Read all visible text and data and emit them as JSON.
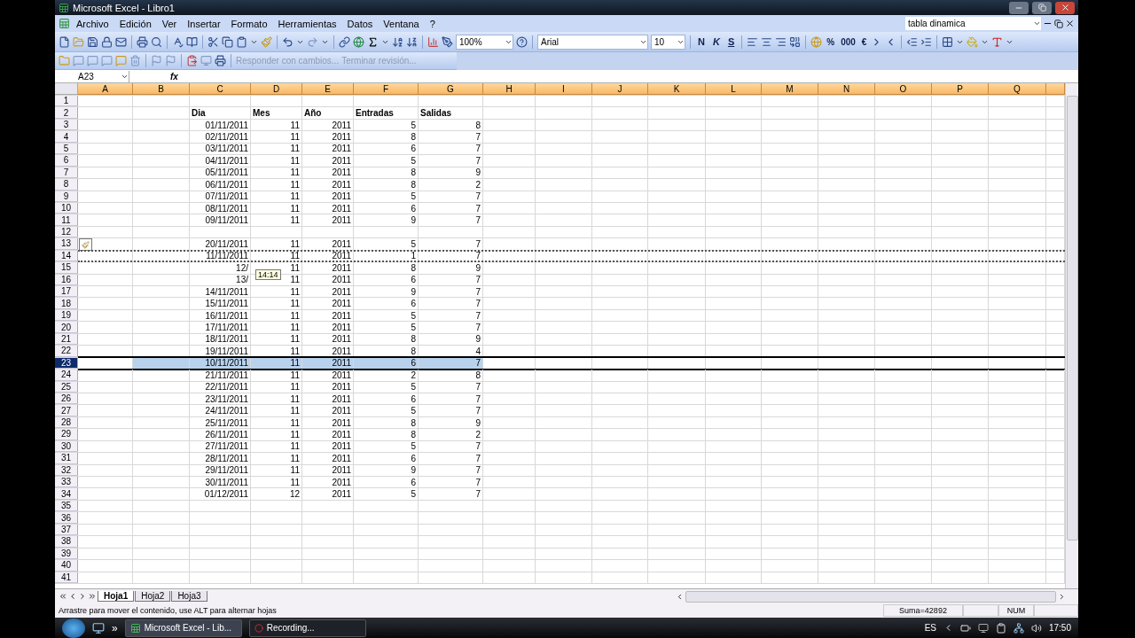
{
  "window": {
    "title": "Microsoft Excel - Libro1"
  },
  "menu": [
    "Archivo",
    "Edición",
    "Ver",
    "Insertar",
    "Formato",
    "Herramientas",
    "Datos",
    "Ventana",
    "?"
  ],
  "help_box": {
    "value": "tabla dinamica"
  },
  "toolbar": {
    "zoom": "100%",
    "font": "Arial",
    "size": "10",
    "style_buttons": [
      "N",
      "K",
      "S"
    ],
    "number_buttons": [
      "%",
      "000",
      "€"
    ]
  },
  "review_toolbar": [
    {
      "label": "Responder con cambios...",
      "disabled": true
    },
    {
      "label": "Terminar revisión...",
      "disabled": true
    }
  ],
  "formula_bar": {
    "name_box": "A23",
    "fx": "fx"
  },
  "columns": [
    "A",
    "B",
    "C",
    "D",
    "E",
    "F",
    "G",
    "H",
    "I",
    "J",
    "K",
    "L",
    "M",
    "N",
    "O",
    "P",
    "Q"
  ],
  "rows": [
    {
      "number": "1",
      "kind": "empty",
      "selected": false,
      "marquee": false,
      "drop_target": false,
      "paste_tag": false
    },
    {
      "number": "2",
      "kind": "header",
      "selected": false,
      "marquee": false,
      "drop_target": false,
      "paste_tag": false,
      "cells": [
        "Dia",
        "Mes",
        "Año",
        "Entradas",
        "Salidas"
      ]
    },
    {
      "number": "3",
      "kind": "data",
      "selected": false,
      "marquee": false,
      "drop_target": false,
      "paste_tag": false,
      "cells": [
        "01/11/2011",
        "11",
        "2011",
        "5",
        "8"
      ]
    },
    {
      "number": "4",
      "kind": "data",
      "selected": false,
      "marquee": false,
      "drop_target": false,
      "paste_tag": false,
      "cells": [
        "02/11/2011",
        "11",
        "2011",
        "8",
        "7"
      ]
    },
    {
      "number": "5",
      "kind": "data",
      "selected": false,
      "marquee": false,
      "drop_target": false,
      "paste_tag": false,
      "cells": [
        "03/11/2011",
        "11",
        "2011",
        "6",
        "7"
      ]
    },
    {
      "number": "6",
      "kind": "data",
      "selected": false,
      "marquee": false,
      "drop_target": false,
      "paste_tag": false,
      "cells": [
        "04/11/2011",
        "11",
        "2011",
        "5",
        "7"
      ]
    },
    {
      "number": "7",
      "kind": "data",
      "selected": false,
      "marquee": false,
      "drop_target": false,
      "paste_tag": false,
      "cells": [
        "05/11/2011",
        "11",
        "2011",
        "8",
        "9"
      ]
    },
    {
      "number": "8",
      "kind": "data",
      "selected": false,
      "marquee": false,
      "drop_target": false,
      "paste_tag": false,
      "cells": [
        "06/11/2011",
        "11",
        "2011",
        "8",
        "2"
      ]
    },
    {
      "number": "9",
      "kind": "data",
      "selected": false,
      "marquee": false,
      "drop_target": false,
      "paste_tag": false,
      "cells": [
        "07/11/2011",
        "11",
        "2011",
        "5",
        "7"
      ]
    },
    {
      "number": "10",
      "kind": "data",
      "selected": false,
      "marquee": false,
      "drop_target": false,
      "paste_tag": false,
      "cells": [
        "08/11/2011",
        "11",
        "2011",
        "6",
        "7"
      ]
    },
    {
      "number": "11",
      "kind": "data",
      "selected": false,
      "marquee": false,
      "drop_target": false,
      "paste_tag": false,
      "cells": [
        "09/11/2011",
        "11",
        "2011",
        "9",
        "7"
      ]
    },
    {
      "number": "12",
      "kind": "empty",
      "selected": false,
      "marquee": false,
      "drop_target": false,
      "paste_tag": false
    },
    {
      "number": "13",
      "kind": "data",
      "selected": false,
      "marquee": false,
      "drop_target": false,
      "paste_tag": true,
      "cells": [
        "20/11/2011",
        "11",
        "2011",
        "5",
        "7"
      ]
    },
    {
      "number": "14",
      "kind": "data",
      "selected": false,
      "marquee": true,
      "drop_target": false,
      "paste_tag": false,
      "cells": [
        "11/11/2011",
        "11",
        "2011",
        "1",
        "7"
      ]
    },
    {
      "number": "15",
      "kind": "data",
      "selected": false,
      "marquee": false,
      "drop_target": false,
      "paste_tag": false,
      "cells": [
        "12/",
        "11",
        "2011",
        "8",
        "9"
      ]
    },
    {
      "number": "16",
      "kind": "data",
      "selected": false,
      "marquee": false,
      "drop_target": false,
      "paste_tag": false,
      "cells": [
        "13/",
        "11",
        "2011",
        "6",
        "7"
      ]
    },
    {
      "number": "17",
      "kind": "data",
      "selected": false,
      "marquee": false,
      "drop_target": false,
      "paste_tag": false,
      "cells": [
        "14/11/2011",
        "11",
        "2011",
        "9",
        "7"
      ]
    },
    {
      "number": "18",
      "kind": "data",
      "selected": false,
      "marquee": false,
      "drop_target": false,
      "paste_tag": false,
      "cells": [
        "15/11/2011",
        "11",
        "2011",
        "6",
        "7"
      ]
    },
    {
      "number": "19",
      "kind": "data",
      "selected": false,
      "marquee": false,
      "drop_target": false,
      "paste_tag": false,
      "cells": [
        "16/11/2011",
        "11",
        "2011",
        "5",
        "7"
      ]
    },
    {
      "number": "20",
      "kind": "data",
      "selected": false,
      "marquee": false,
      "drop_target": false,
      "paste_tag": false,
      "cells": [
        "17/11/2011",
        "11",
        "2011",
        "5",
        "7"
      ]
    },
    {
      "number": "21",
      "kind": "data",
      "selected": false,
      "marquee": false,
      "drop_target": false,
      "paste_tag": false,
      "cells": [
        "18/11/2011",
        "11",
        "2011",
        "8",
        "9"
      ]
    },
    {
      "number": "22",
      "kind": "data",
      "selected": false,
      "marquee": false,
      "drop_target": false,
      "paste_tag": false,
      "cells": [
        "19/11/2011",
        "11",
        "2011",
        "8",
        "4"
      ]
    },
    {
      "number": "23",
      "kind": "data",
      "selected": true,
      "marquee": false,
      "drop_target": true,
      "paste_tag": false,
      "cells": [
        "10/11/2011",
        "11",
        "2011",
        "6",
        "7"
      ]
    },
    {
      "number": "24",
      "kind": "data",
      "selected": false,
      "marquee": false,
      "drop_target": false,
      "paste_tag": false,
      "cells": [
        "21/11/2011",
        "11",
        "2011",
        "2",
        "8"
      ]
    },
    {
      "number": "25",
      "kind": "data",
      "selected": false,
      "marquee": false,
      "drop_target": false,
      "paste_tag": false,
      "cells": [
        "22/11/2011",
        "11",
        "2011",
        "5",
        "7"
      ]
    },
    {
      "number": "26",
      "kind": "data",
      "selected": false,
      "marquee": false,
      "drop_target": false,
      "paste_tag": false,
      "cells": [
        "23/11/2011",
        "11",
        "2011",
        "6",
        "7"
      ]
    },
    {
      "number": "27",
      "kind": "data",
      "selected": false,
      "marquee": false,
      "drop_target": false,
      "paste_tag": false,
      "cells": [
        "24/11/2011",
        "11",
        "2011",
        "5",
        "7"
      ]
    },
    {
      "number": "28",
      "kind": "data",
      "selected": false,
      "marquee": false,
      "drop_target": false,
      "paste_tag": false,
      "cells": [
        "25/11/2011",
        "11",
        "2011",
        "8",
        "9"
      ]
    },
    {
      "number": "29",
      "kind": "data",
      "selected": false,
      "marquee": false,
      "drop_target": false,
      "paste_tag": false,
      "cells": [
        "26/11/2011",
        "11",
        "2011",
        "8",
        "2"
      ]
    },
    {
      "number": "30",
      "kind": "data",
      "selected": false,
      "marquee": false,
      "drop_target": false,
      "paste_tag": false,
      "cells": [
        "27/11/2011",
        "11",
        "2011",
        "5",
        "7"
      ]
    },
    {
      "number": "31",
      "kind": "data",
      "selected": false,
      "marquee": false,
      "drop_target": false,
      "paste_tag": false,
      "cells": [
        "28/11/2011",
        "11",
        "2011",
        "6",
        "7"
      ]
    },
    {
      "number": "32",
      "kind": "data",
      "selected": false,
      "marquee": false,
      "drop_target": false,
      "paste_tag": false,
      "cells": [
        "29/11/2011",
        "11",
        "2011",
        "9",
        "7"
      ]
    },
    {
      "number": "33",
      "kind": "data",
      "selected": false,
      "marquee": false,
      "drop_target": false,
      "paste_tag": false,
      "cells": [
        "30/11/2011",
        "11",
        "2011",
        "6",
        "7"
      ]
    },
    {
      "number": "34",
      "kind": "data",
      "selected": false,
      "marquee": false,
      "drop_target": false,
      "paste_tag": false,
      "cells": [
        "01/12/2011",
        "12",
        "2011",
        "5",
        "7"
      ]
    },
    {
      "number": "35",
      "kind": "empty",
      "selected": false,
      "marquee": false,
      "drop_target": false,
      "paste_tag": false
    },
    {
      "number": "36",
      "kind": "empty",
      "selected": false,
      "marquee": false,
      "drop_target": false,
      "paste_tag": false
    },
    {
      "number": "37",
      "kind": "empty",
      "selected": false,
      "marquee": false,
      "drop_target": false,
      "paste_tag": false
    },
    {
      "number": "38",
      "kind": "empty",
      "selected": false,
      "marquee": false,
      "drop_target": false,
      "paste_tag": false
    },
    {
      "number": "39",
      "kind": "empty",
      "selected": false,
      "marquee": false,
      "drop_target": false,
      "paste_tag": false
    },
    {
      "number": "40",
      "kind": "empty",
      "selected": false,
      "marquee": false,
      "drop_target": false,
      "paste_tag": false
    },
    {
      "number": "41",
      "kind": "empty",
      "selected": false,
      "marquee": false,
      "drop_target": false,
      "paste_tag": false
    }
  ],
  "drag_tooltip": {
    "text": "14:14"
  },
  "sheet_tabs": [
    {
      "label": "Hoja1",
      "selected": true
    },
    {
      "label": "Hoja2",
      "selected": false
    },
    {
      "label": "Hoja3",
      "selected": false
    }
  ],
  "status_bar": {
    "message": "Arrastre para mover el contenido, use ALT para alternar hojas",
    "sum": "Suma=42892",
    "num": "NUM"
  },
  "taskbar": {
    "more": "»",
    "tasks": [
      {
        "label": "Microsoft Excel - Lib...",
        "selected": true
      },
      {
        "label": "Recording...",
        "selected": false
      }
    ],
    "language": "ES",
    "clock": "17:50"
  }
}
